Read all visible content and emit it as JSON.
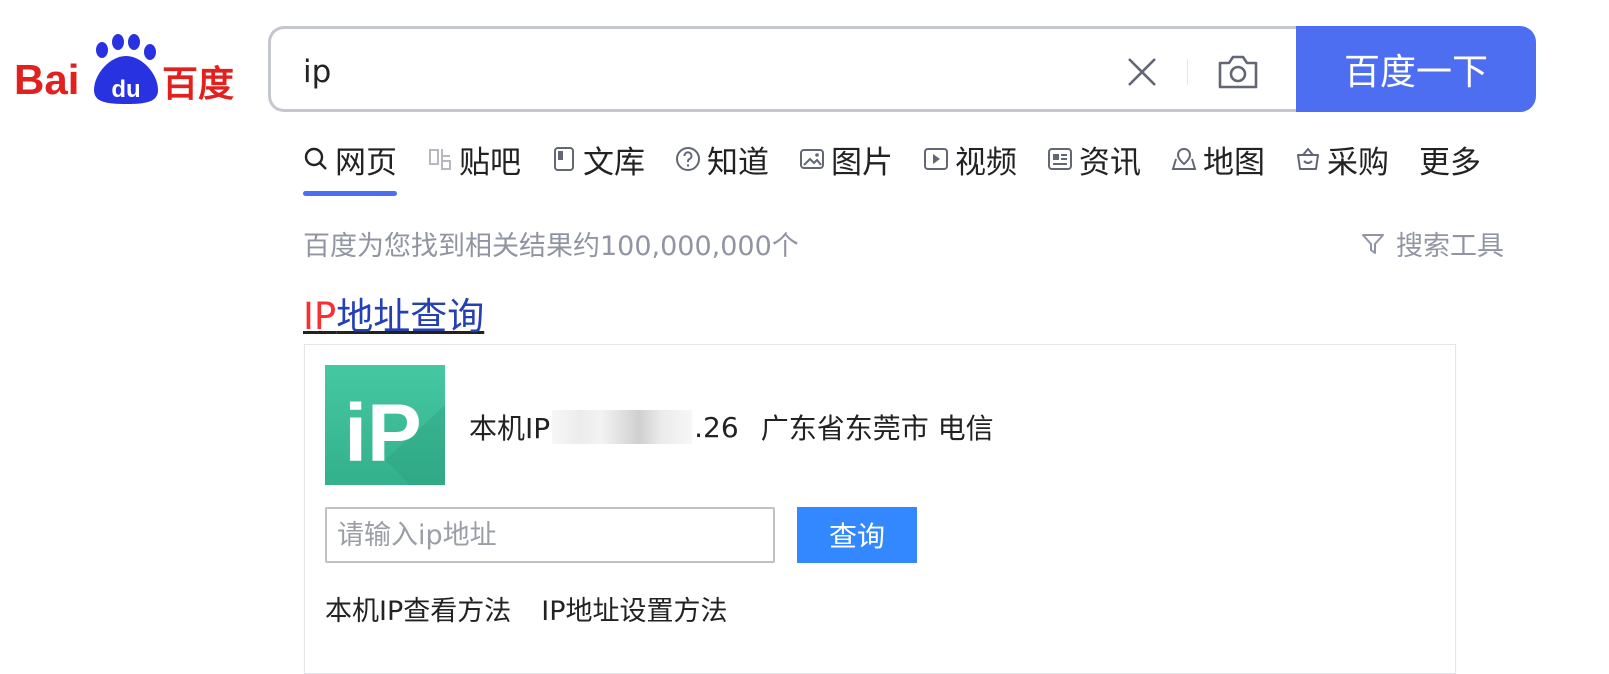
{
  "logo": {
    "text_bai": "Bai",
    "text_du": "du",
    "text_cn": "百度"
  },
  "search": {
    "value": "ip",
    "button_label": "百度一下"
  },
  "tabs": [
    {
      "label": "网页",
      "icon": "search-icon",
      "active": true
    },
    {
      "label": "贴吧",
      "icon": "tieba-icon"
    },
    {
      "label": "文库",
      "icon": "doc-icon"
    },
    {
      "label": "知道",
      "icon": "question-icon"
    },
    {
      "label": "图片",
      "icon": "image-icon"
    },
    {
      "label": "视频",
      "icon": "video-icon"
    },
    {
      "label": "资讯",
      "icon": "news-icon"
    },
    {
      "label": "地图",
      "icon": "map-icon"
    },
    {
      "label": "采购",
      "icon": "shopping-icon"
    },
    {
      "label": "更多"
    }
  ],
  "results": {
    "count_text": "百度为您找到相关结果约100,000,000个",
    "tools_label": "搜索工具",
    "title_highlight": "IP",
    "title_rest": "地址查询"
  },
  "card": {
    "logo_text": "iP",
    "ip_prefix": "本机IP",
    "ip_suffix": ".26",
    "location": "广东省东莞市 电信",
    "input_placeholder": "请输入ip地址",
    "query_label": "查询",
    "links": [
      "本机IP查看方法",
      "IP地址设置方法"
    ]
  },
  "colors": {
    "accent": "#4e6ef2",
    "query_button": "#3388ff",
    "highlight": "#f73131",
    "link": "#2440b3",
    "ip_logo": "#3fbf97"
  }
}
